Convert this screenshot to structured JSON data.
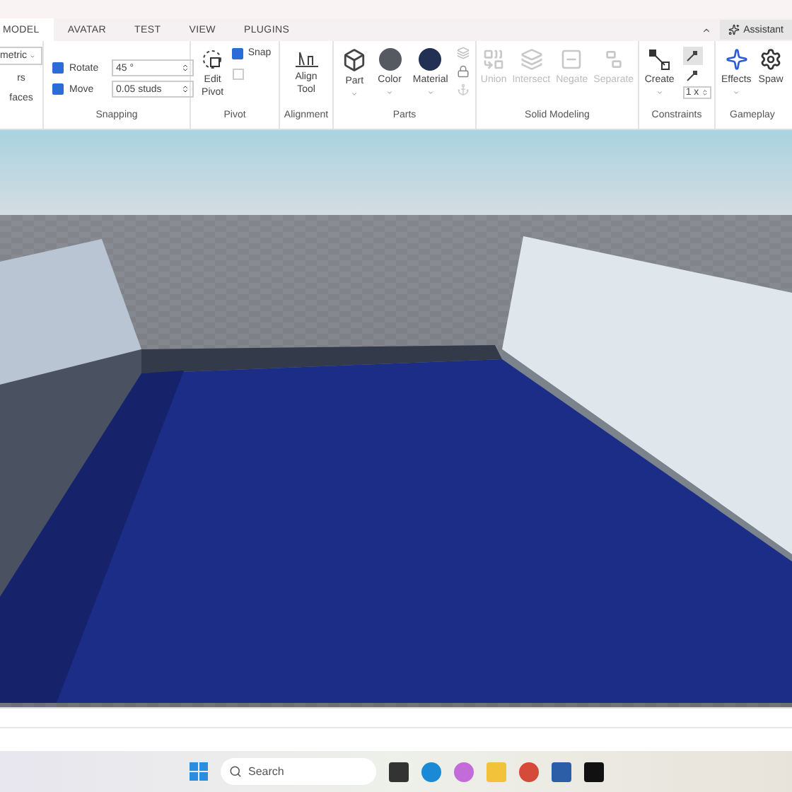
{
  "tabs": [
    {
      "label": "MODEL",
      "selected": true
    },
    {
      "label": "AVATAR",
      "selected": false
    },
    {
      "label": "TEST",
      "selected": false
    },
    {
      "label": "VIEW",
      "selected": false
    },
    {
      "label": "PLUGINS",
      "selected": false
    }
  ],
  "assistant": {
    "label": "Assistant"
  },
  "ribbon": {
    "tools": {
      "mode": "metric",
      "items": [
        "rs",
        "faces"
      ]
    },
    "snapping": {
      "label": "Snapping",
      "rows": [
        {
          "label": "Rotate",
          "checked": true,
          "value": "45 °"
        },
        {
          "label": "Move",
          "checked": true,
          "value": "0.05 studs"
        }
      ]
    },
    "pivot": {
      "label": "Pivot",
      "button": "Edit\nPivot",
      "snap": {
        "label": "Snap",
        "checked": true
      }
    },
    "alignment": {
      "label": "Alignment",
      "button": "Align\nTool"
    },
    "parts": {
      "label": "Parts",
      "buttons": [
        {
          "kind": "part",
          "label": "Part"
        },
        {
          "kind": "color",
          "label": "Color"
        },
        {
          "kind": "material",
          "label": "Material"
        }
      ]
    },
    "solid_modeling": {
      "label": "Solid Modeling",
      "buttons": [
        {
          "label": "Union",
          "disabled": true
        },
        {
          "label": "Intersect",
          "disabled": true
        },
        {
          "label": "Negate",
          "disabled": true
        },
        {
          "label": "Separate",
          "disabled": true
        }
      ]
    },
    "constraints": {
      "label": "Constraints",
      "button": "Create",
      "toggles": [
        {
          "selected": true
        },
        {
          "selected": false
        }
      ],
      "scale": "1 x"
    },
    "gameplay": {
      "label": "Gameplay",
      "buttons": [
        {
          "kind": "effects",
          "label": "Effects"
        },
        {
          "kind": "spawn",
          "label": "Spaw"
        }
      ]
    }
  },
  "taskbar": {
    "search": {
      "placeholder": "Search"
    }
  }
}
